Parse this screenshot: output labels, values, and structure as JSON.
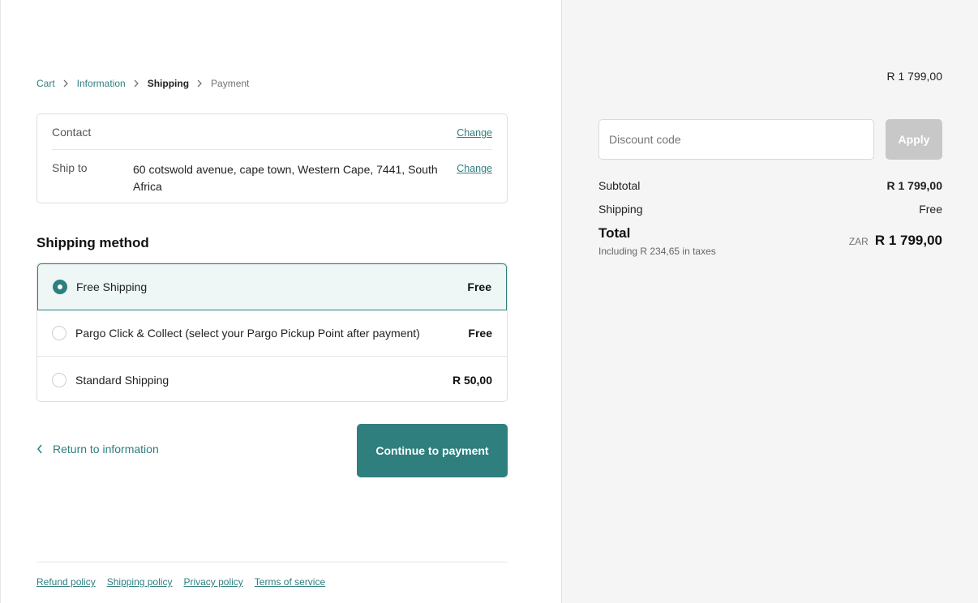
{
  "breadcrumb": {
    "cart": "Cart",
    "information": "Information",
    "shipping": "Shipping",
    "payment": "Payment"
  },
  "info": {
    "contact_label": "Contact",
    "contact_change": "Change",
    "ship_to_label": "Ship to",
    "ship_to_value": "60 cotswold avenue, cape town, Western Cape, 7441, South Africa",
    "ship_to_change": "Change"
  },
  "shipping_method": {
    "title": "Shipping method",
    "options": [
      {
        "label": "Free Shipping",
        "price": "Free",
        "selected": true
      },
      {
        "label": "Pargo Click & Collect (select your Pargo Pickup Point after payment)",
        "price": "Free",
        "selected": false
      },
      {
        "label": "Standard Shipping",
        "price": "R 50,00",
        "selected": false
      }
    ]
  },
  "actions": {
    "return_label": "Return to information",
    "continue_label": "Continue to payment"
  },
  "footer": {
    "links": [
      "Refund policy",
      "Shipping policy",
      "Privacy policy",
      "Terms of service"
    ]
  },
  "summary": {
    "top_price": "R 1 799,00",
    "discount_placeholder": "Discount code",
    "apply_label": "Apply",
    "subtotal_label": "Subtotal",
    "subtotal_value": "R 1 799,00",
    "shipping_label": "Shipping",
    "shipping_value": "Free",
    "total_label": "Total",
    "tax_note": "Including R 234,65 in taxes",
    "currency": "ZAR",
    "total_value": "R 1 799,00"
  },
  "colors": {
    "accent": "#2e7f7e",
    "selected_bg": "#eef6f6",
    "apply_disabled": "#c8c8c8",
    "sidebar_bg": "#f5f5f5"
  },
  "icons": {
    "breadcrumb_separator": "chevron-right-icon",
    "return": "chevron-left-icon",
    "radio_selected": "radio-checked-icon",
    "radio_unselected": "radio-unchecked-icon"
  }
}
